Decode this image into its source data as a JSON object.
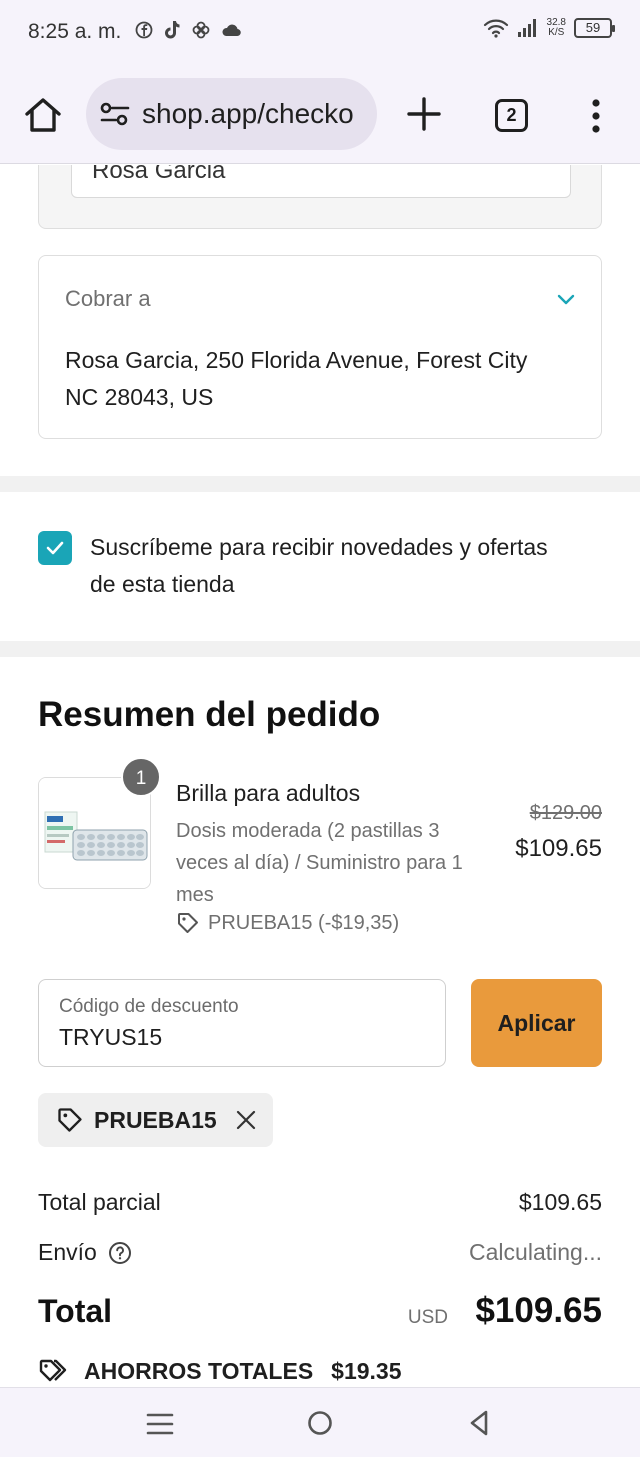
{
  "status_bar": {
    "time": "8:25 a. m.",
    "net_speed_value": "32.8",
    "net_speed_unit": "K/S",
    "battery": "59",
    "left_icons": [
      "facebook-icon",
      "tiktok-icon",
      "pinwheel-icon",
      "cloud-icon"
    ],
    "right_icons": [
      "wifi-icon",
      "signal-icon",
      "battery-icon"
    ]
  },
  "browser": {
    "url": "shop.app/checko",
    "tab_count": "2",
    "icons": [
      "home-icon",
      "site-settings-icon",
      "new-tab-icon",
      "tabs-icon",
      "more-icon"
    ]
  },
  "shipping_card": {
    "name_value": "Rosa Garcia"
  },
  "billing": {
    "label": "Cobrar a",
    "address_line1": "Rosa Garcia, 250 Florida Avenue, Forest City",
    "address_line2": "NC 28043, US"
  },
  "newsletter": {
    "checked": true,
    "text_line1": "Suscríbeme para recibir novedades y ofertas",
    "text_line2": "de esta tienda"
  },
  "order_summary": {
    "title": "Resumen del pedido",
    "product": {
      "quantity": "1",
      "name": "Brilla para adultos",
      "variant_line1": "Dosis moderada (2 pastillas 3",
      "variant_line2": "veces al día) / Suministro para 1",
      "variant_line3": "mes",
      "discount": "PRUEBA15 (-$19,35)",
      "price_original": "$129.00",
      "price_final": "$109.65"
    },
    "discount_code": {
      "label": "Código de descuento",
      "value": "TRYUS15",
      "apply_label": "Aplicar"
    },
    "applied_discount": "PRUEBA15",
    "subtotal_label": "Total parcial",
    "subtotal_value": "$109.65",
    "shipping_label": "Envío",
    "shipping_value": "Calculating...",
    "total_label": "Total",
    "total_currency": "USD",
    "total_value": "$109.65",
    "savings_label": "AHORROS TOTALES",
    "savings_value": "$19.35"
  },
  "colors": {
    "accent_teal": "#1aa5b7",
    "apply_button": "#e99a3c",
    "system_bar": "#f6f3fb"
  }
}
